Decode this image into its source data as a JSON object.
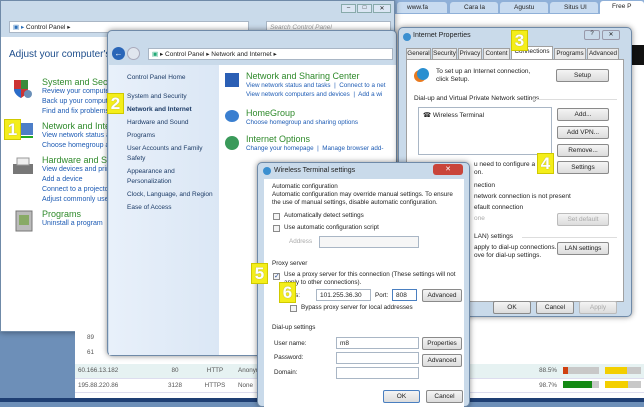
{
  "browser": {
    "tabs": [
      "www.fa",
      "Cara la",
      "Agustu",
      "Situs UI",
      "Free P"
    ]
  },
  "control_panel": {
    "breadcrumb": [
      "Control Panel"
    ],
    "search_placeholder": "Search Control Panel",
    "heading": "Adjust your computer's se",
    "categories": [
      {
        "title": "System and Secu",
        "links": [
          "Review your computer",
          "Back up your compute",
          "Find and fix problems"
        ]
      },
      {
        "title": "Network and Inte",
        "links": [
          "View network status an",
          "Choose homegroup an"
        ]
      },
      {
        "title": "Hardware and So",
        "links": [
          "View devices and printe",
          "Add a device",
          "Connect to a projector",
          "Adjust commonly use"
        ]
      },
      {
        "title": "Programs",
        "links": [
          "Uninstall a program"
        ]
      }
    ]
  },
  "network_window": {
    "breadcrumb": [
      "Control Panel",
      "Network and Internet"
    ],
    "sidebar": [
      "Control Panel Home",
      "System and Security",
      "Network and Internet",
      "Hardware and Sound",
      "Programs",
      "User Accounts and Family Safety",
      "Appearance and Personalization",
      "Clock, Language, and Region",
      "Ease of Access"
    ],
    "sections": [
      {
        "title": "Network and Sharing Center",
        "links": [
          "View network status and tasks",
          "Connect to a net",
          "View network computers and devices",
          "Add a wi"
        ]
      },
      {
        "title": "HomeGroup",
        "links": [
          "Choose homegroup and sharing options"
        ]
      },
      {
        "title": "Internet Options",
        "links": [
          "Change your homepage",
          "Manage browser add-"
        ]
      }
    ]
  },
  "internet_properties": {
    "title": "Internet Properties",
    "tabs": [
      "General",
      "Security",
      "Privacy",
      "Content",
      "Connections",
      "Programs",
      "Advanced"
    ],
    "setup_text": "To set up an Internet connection, click Setup.",
    "setup_button": "Setup",
    "dialup_heading": "Dial-up and Virtual Private Network settings",
    "connections": [
      "Wireless Terminal"
    ],
    "add_button": "Add...",
    "add_vpn_button": "Add VPN...",
    "remove_button": "Remove...",
    "settings_button": "Settings",
    "settings_text": "u need to configure a pr",
    "settings_text2": "on.",
    "option1": "nection",
    "option2": "network connection is not present",
    "option3": "efault connection",
    "current": "one",
    "set_default_button": "Set default",
    "lan_heading": "LAN) settings",
    "lan_text": "apply to dial-up connections.",
    "lan_text2": "ove for dial-up settings.",
    "lan_button": "LAN settings",
    "ok": "OK",
    "cancel": "Cancel",
    "apply": "Apply"
  },
  "wireless_dialog": {
    "title": "Wireless Terminal settings",
    "auto_heading": "Automatic configuration",
    "auto_text": "Automatic configuration may override manual settings.  To ensure the use of manual settings, disable automatic configuration.",
    "auto_detect": "Automatically detect settings",
    "auto_script": "Use automatic configuration script",
    "address_label": "Address",
    "proxy_heading": "Proxy server",
    "use_proxy": "Use a proxy server for this connection (These settings will not apply to other connections).",
    "proxy_address_label": "ss:",
    "proxy_address": "101.255.36.30",
    "port_label": "Port:",
    "port": "808",
    "advanced": "Advanced",
    "bypass": "Bypass proxy server for local addresses",
    "dialup_heading": "Dial-up settings",
    "username_label": "User name:",
    "username": "m8",
    "password_label": "Password:",
    "domain_label": "Domain:",
    "properties": "Properties",
    "advanced2": "Advanced",
    "ok": "OK",
    "cancel": "Cancel"
  },
  "proxy_table": {
    "partial_rows": [
      "89",
      "61"
    ],
    "rows": [
      {
        "ip": "60.166.13.182",
        "port": "80",
        "type": "HTTP",
        "anon": "Anonym",
        "uptime": "88.5%",
        "speed": 0.15,
        "conn": 0.6,
        "speed_color": "#d04010",
        "conn_color": "#f3cf00"
      },
      {
        "ip": "195.88.220.86",
        "port": "3128",
        "type": "HTTPS",
        "anon": "None",
        "uptime": "98.7%",
        "speed": 0.8,
        "conn": 0.65,
        "speed_color": "#148a14",
        "conn_color": "#f3cf00"
      }
    ]
  },
  "badges": [
    "1",
    "2",
    "3",
    "4",
    "5",
    "6"
  ]
}
